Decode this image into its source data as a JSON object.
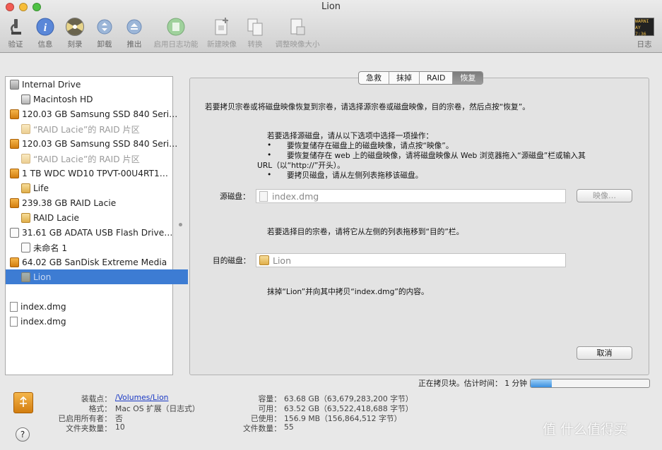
{
  "window": {
    "title": "Lion"
  },
  "toolbar": {
    "verify": "验证",
    "info": "信息",
    "burn": "刻录",
    "unmount": "卸载",
    "eject": "推出",
    "enable_journaling": "启用日志功能",
    "new_image": "新建映像",
    "convert": "转换",
    "resize_image": "调整映像大小",
    "log": "日志",
    "log_badge_line1": "WARNI",
    "log_badge_line2": "AY 7:36"
  },
  "sidebar": {
    "items": [
      {
        "label": "Internal Drive",
        "icon": "internal-drive-icon"
      },
      {
        "label": "Macintosh HD",
        "icon": "hard-disk-icon"
      },
      {
        "label": "120.03 GB Samsung SSD 840 Seri…",
        "icon": "external-drive-icon"
      },
      {
        "label": "“RAID Lacie”的 RAID 片区",
        "icon": "raid-slice-icon"
      },
      {
        "label": "120.03 GB Samsung SSD 840 Seri…",
        "icon": "external-drive-icon"
      },
      {
        "label": "“RAID Lacie”的 RAID 片区",
        "icon": "raid-slice-icon"
      },
      {
        "label": "1 TB WDC WD10 TPVT-00U4RT1…",
        "icon": "external-drive-icon"
      },
      {
        "label": "Life",
        "icon": "volume-icon"
      },
      {
        "label": "239.38 GB RAID Lacie",
        "icon": "raid-drive-icon"
      },
      {
        "label": "RAID Lacie",
        "icon": "volume-icon"
      },
      {
        "label": "31.61 GB ADATA USB Flash Drive…",
        "icon": "usb-drive-icon"
      },
      {
        "label": "未命名 1",
        "icon": "volume-icon"
      },
      {
        "label": "64.02 GB SanDisk Extreme Media",
        "icon": "external-drive-icon"
      },
      {
        "label": "Lion",
        "icon": "volume-icon"
      },
      {
        "label": "index.dmg",
        "icon": "disk-image-icon"
      },
      {
        "label": "index.dmg",
        "icon": "disk-image-icon"
      }
    ]
  },
  "tabs": [
    "急救",
    "抹掉",
    "RAID",
    "恢复"
  ],
  "restore": {
    "intro": "若要拷贝宗卷或将磁盘映像恢复到宗卷，请选择源宗卷或磁盘映像，目的宗卷，然后点按“恢复”。",
    "source_help_title": "若要选择源磁盘，请从以下选项中选择一项操作：",
    "source_help_1": "要恢复储存在磁盘上的磁盘映像，请点按“映像”。",
    "source_help_2a": "要恢复储存在 web 上的磁盘映像，请将磁盘映像从 Web 浏览器拖入“源磁盘”栏或输入其",
    "source_help_2b": "URL（以“http://”开头）。",
    "source_help_3": "要拷贝磁盘，请从左侧列表拖移该磁盘。",
    "bullet": "•",
    "source_label": "源磁盘：",
    "source_value": "index.dmg",
    "image_button": "映像…",
    "dest_help": "若要选择目的宗卷，请将它从左侧的列表拖移到“目的”栏。",
    "dest_label": "目的磁盘：",
    "dest_value": "Lion",
    "status_note": "抹掉“Lion”并向其中拷贝“index.dmg”的内容。",
    "cancel_button": "取消"
  },
  "progress": {
    "text": "正在拷贝块。估计时间： 1 分钟",
    "fraction": 0.18,
    "accent": "#3a8fe0"
  },
  "details": {
    "mount_point_label": "装载点：",
    "mount_point_value": "/Volumes/Lion",
    "format_label": "格式：",
    "format_value": "Mac OS 扩展（日志式）",
    "owners_label": "已启用所有者：",
    "owners_value": "否",
    "folders_label": "文件夹数量：",
    "folders_value": "10",
    "capacity_label": "容量：",
    "capacity_value": "63.68 GB（63,679,283,200 字节）",
    "available_label": "可用：",
    "available_value": "63.52 GB（63,522,418,688 字节）",
    "used_label": "已使用：",
    "used_value": "156.9 MB（156,864,512 字节）",
    "files_label": "文件数量：",
    "files_value": "55"
  },
  "help_glyph": "?",
  "watermark": "值 什么值得买"
}
